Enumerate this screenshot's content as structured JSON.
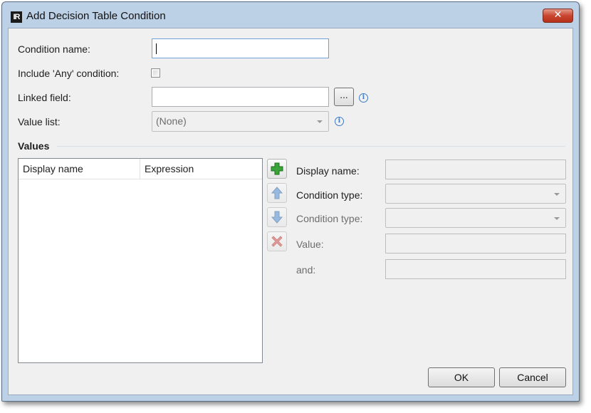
{
  "window": {
    "title": "Add Decision Table Condition",
    "app_icon_text": "IR",
    "close_symbol": "✕"
  },
  "form": {
    "condition_name_label": "Condition name:",
    "condition_name_value": "",
    "include_any_label": "Include 'Any' condition:",
    "include_any_checked": false,
    "linked_field_label": "Linked field:",
    "linked_field_value": "",
    "browse_label": "...",
    "value_list_label": "Value list:",
    "value_list_selected": "(None)",
    "info_symbol": "i"
  },
  "values": {
    "section_title": "Values",
    "columns": [
      "Display name",
      "Expression"
    ],
    "rows": [],
    "toolbar": {
      "add_icon": "add-icon",
      "up_icon": "move-up-icon",
      "down_icon": "move-down-icon",
      "delete_icon": "delete-icon"
    },
    "detail": {
      "display_name_label": "Display name:",
      "condition_type_label_1": "Condition type:",
      "condition_type_label_2": "Condition type:",
      "value_label": "Value:",
      "and_label": "and:"
    }
  },
  "buttons": {
    "ok_label": "OK",
    "cancel_label": "Cancel"
  },
  "colors": {
    "frame": "#bcd0e6",
    "client": "#f0f0f0",
    "close_button": "#c84630",
    "add_green": "#3aa33a",
    "arrow_blue": "#4d8fd6",
    "delete_red": "#d9534f"
  }
}
